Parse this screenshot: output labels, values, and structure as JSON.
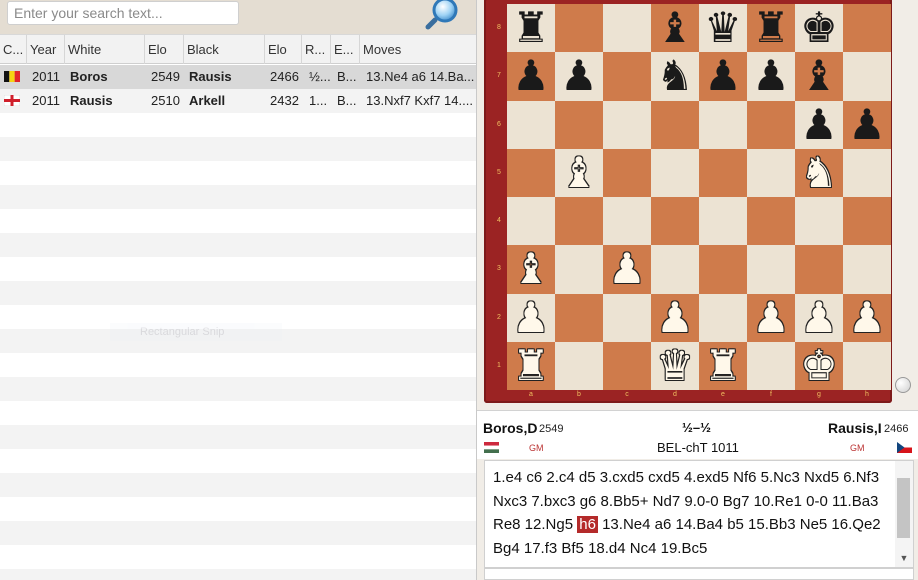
{
  "search": {
    "placeholder": "Enter your search text...",
    "value": "",
    "icon": "magnifier-icon"
  },
  "grid": {
    "columns": [
      "C...",
      "Year",
      "White",
      "Elo",
      "Black",
      "Elo",
      "R...",
      "E...",
      "Moves"
    ],
    "rows": [
      {
        "flag": "belgium",
        "year": "2011",
        "white": "Boros",
        "white_elo": "2549",
        "black": "Rausis",
        "black_elo": "2466",
        "result": "½...",
        "event": "B...",
        "moves": "13.Ne4 a6 14.Ba..."
      },
      {
        "flag": "england",
        "year": "2011",
        "white": "Rausis",
        "white_elo": "2510",
        "black": "Arkell",
        "black_elo": "2432",
        "result": "1...",
        "event": "B...",
        "moves": "13.Nxf7 Kxf7 14...."
      }
    ],
    "ghost_label": "Rectangular Snip"
  },
  "board": {
    "files": [
      "a",
      "b",
      "c",
      "d",
      "e",
      "f",
      "g",
      "h"
    ],
    "ranks": [
      "8",
      "7",
      "6",
      "5",
      "4",
      "3",
      "2",
      "1"
    ],
    "position": [
      [
        "r",
        "",
        "",
        "b",
        "q",
        "r",
        "k",
        ""
      ],
      [
        "p",
        "p",
        "",
        "n",
        "p",
        "p",
        "b",
        ""
      ],
      [
        "",
        "",
        "",
        "",
        "",
        "",
        "p",
        "p"
      ],
      [
        "",
        "B",
        "",
        "",
        "",
        "",
        "N",
        ""
      ],
      [
        "",
        "",
        "",
        "",
        "",
        "",
        "",
        ""
      ],
      [
        "B",
        "",
        "P",
        "",
        "",
        "",
        "",
        ""
      ],
      [
        "P",
        "",
        "",
        "P",
        "",
        "P",
        "P",
        "P"
      ],
      [
        "R",
        "",
        "",
        "Q",
        "R",
        "",
        "K",
        ""
      ]
    ]
  },
  "game": {
    "white_name": "Boros,D",
    "white_elo": "2549",
    "white_title": "GM",
    "white_flag": "hungary",
    "black_name": "Rausis,I",
    "black_elo": "2466",
    "black_title": "GM",
    "black_flag": "czech",
    "result": "½–½",
    "event": "BEL-chT 1011"
  },
  "notation": {
    "before": "1.e4 c6 2.c4 d5 3.cxd5 cxd5 4.exd5 Nf6 5.Nc3 Nxd5 6.Nf3 Nxc3 7.bxc3 g6 8.Bb5+ Nd7 9.0-0 Bg7 10.Re1 0-0 11.Ba3 Re8 12.Ng5",
    "current": "h6",
    "after": "13.Ne4 a6 14.Ba4 b5 15.Bb3 Ne5 16.Qe2 Bg4 17.f3 Bf5 18.d4 Nc4 19.Bc5"
  }
}
